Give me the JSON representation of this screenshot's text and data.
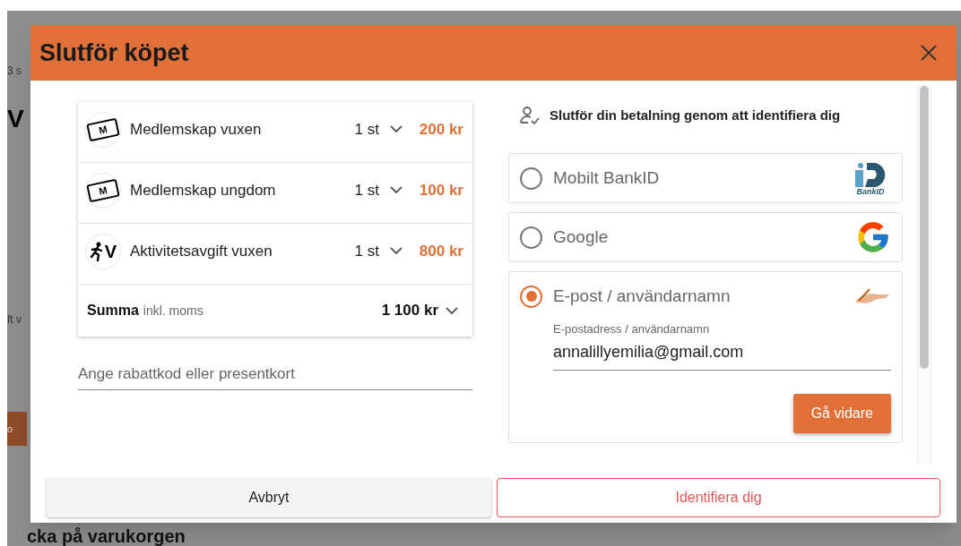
{
  "background": {
    "fragments": [
      "3 s",
      "V",
      "ft v",
      "o"
    ],
    "heading": "cka på varukorgen"
  },
  "dialog": {
    "title": "Slutför köpet",
    "items": [
      {
        "kind": "ticket",
        "icon_letter": "M",
        "name": "Medlemskap vuxen",
        "qty": "1 st",
        "price": "200 kr"
      },
      {
        "kind": "ticket",
        "icon_letter": "M",
        "name": "Medlemskap ungdom",
        "qty": "1 st",
        "price": "100 kr"
      },
      {
        "kind": "runner",
        "icon_letter": "V",
        "name": "Aktivitetsavgift vuxen",
        "qty": "1 st",
        "price": "800 kr"
      }
    ],
    "summary": {
      "label": "Summa",
      "note": "inkl. moms",
      "total": "1 100 kr"
    },
    "discount": {
      "placeholder": "Ange rabattkod eller presentkort"
    },
    "identify": {
      "heading": "Slutför din betalning genom att identifiera dig",
      "methods": [
        {
          "kind": "bankid",
          "label": "Mobilt BankID",
          "logo_text": "BankID",
          "selected": false
        },
        {
          "kind": "google",
          "label": "Google",
          "selected": false
        },
        {
          "kind": "email",
          "label": "E-post / användarnamn",
          "selected": true,
          "field_label": "E-postadress / användarnamn",
          "value": "annalillyemilia@gmail.com",
          "button": "Gå vidare"
        }
      ]
    },
    "footer": {
      "cancel": "Avbryt",
      "confirm": "Identifiera dig"
    }
  }
}
